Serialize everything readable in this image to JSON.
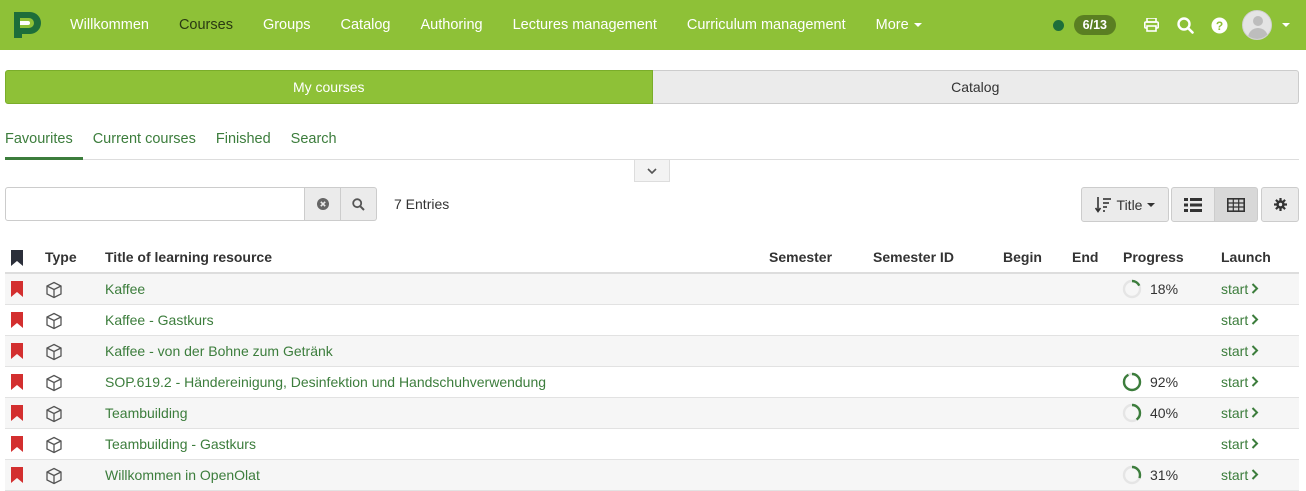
{
  "navbar": {
    "items": [
      {
        "label": "Willkommen",
        "active": false
      },
      {
        "label": "Courses",
        "active": true
      },
      {
        "label": "Groups",
        "active": false
      },
      {
        "label": "Catalog",
        "active": false
      },
      {
        "label": "Authoring",
        "active": false
      },
      {
        "label": "Lectures management",
        "active": false
      },
      {
        "label": "Curriculum management",
        "active": false
      },
      {
        "label": "More",
        "active": false
      }
    ],
    "online_count": "6/13",
    "icons": [
      "printer-icon",
      "search-icon",
      "help-icon",
      "user-avatar"
    ]
  },
  "segments": {
    "my_courses": "My courses",
    "catalog": "Catalog"
  },
  "tabs": [
    "Favourites",
    "Current courses",
    "Finished",
    "Search"
  ],
  "search": {
    "placeholder": "",
    "value": ""
  },
  "entries_label": "7 Entries",
  "sort_label": "Title",
  "table": {
    "headers": {
      "type": "Type",
      "title": "Title of learning resource",
      "semester": "Semester",
      "semester_id": "Semester ID",
      "begin": "Begin",
      "end": "End",
      "progress": "Progress",
      "launch": "Launch"
    },
    "rows": [
      {
        "title": "Kaffee",
        "progress": "18%",
        "progress_value": 0.18,
        "launch": "start"
      },
      {
        "title": "Kaffee - Gastkurs",
        "progress": "",
        "progress_value": null,
        "launch": "start"
      },
      {
        "title": "Kaffee - von der Bohne zum Getränk",
        "progress": "",
        "progress_value": null,
        "launch": "start"
      },
      {
        "title": "SOP.619.2 - Händereinigung, Desinfektion und Handschuhverwendung",
        "progress": "92%",
        "progress_value": 0.92,
        "launch": "start"
      },
      {
        "title": "Teambuilding",
        "progress": "40%",
        "progress_value": 0.4,
        "launch": "start"
      },
      {
        "title": "Teambuilding - Gastkurs",
        "progress": "",
        "progress_value": null,
        "launch": "start"
      },
      {
        "title": "Willkommen in OpenOlat",
        "progress": "31%",
        "progress_value": 0.31,
        "launch": "start"
      }
    ]
  },
  "colors": {
    "brand_green": "#8ec137",
    "link_green": "#3c7d3c",
    "bookmark_red": "#d32f2f",
    "status_green": "#1d6e3a"
  }
}
